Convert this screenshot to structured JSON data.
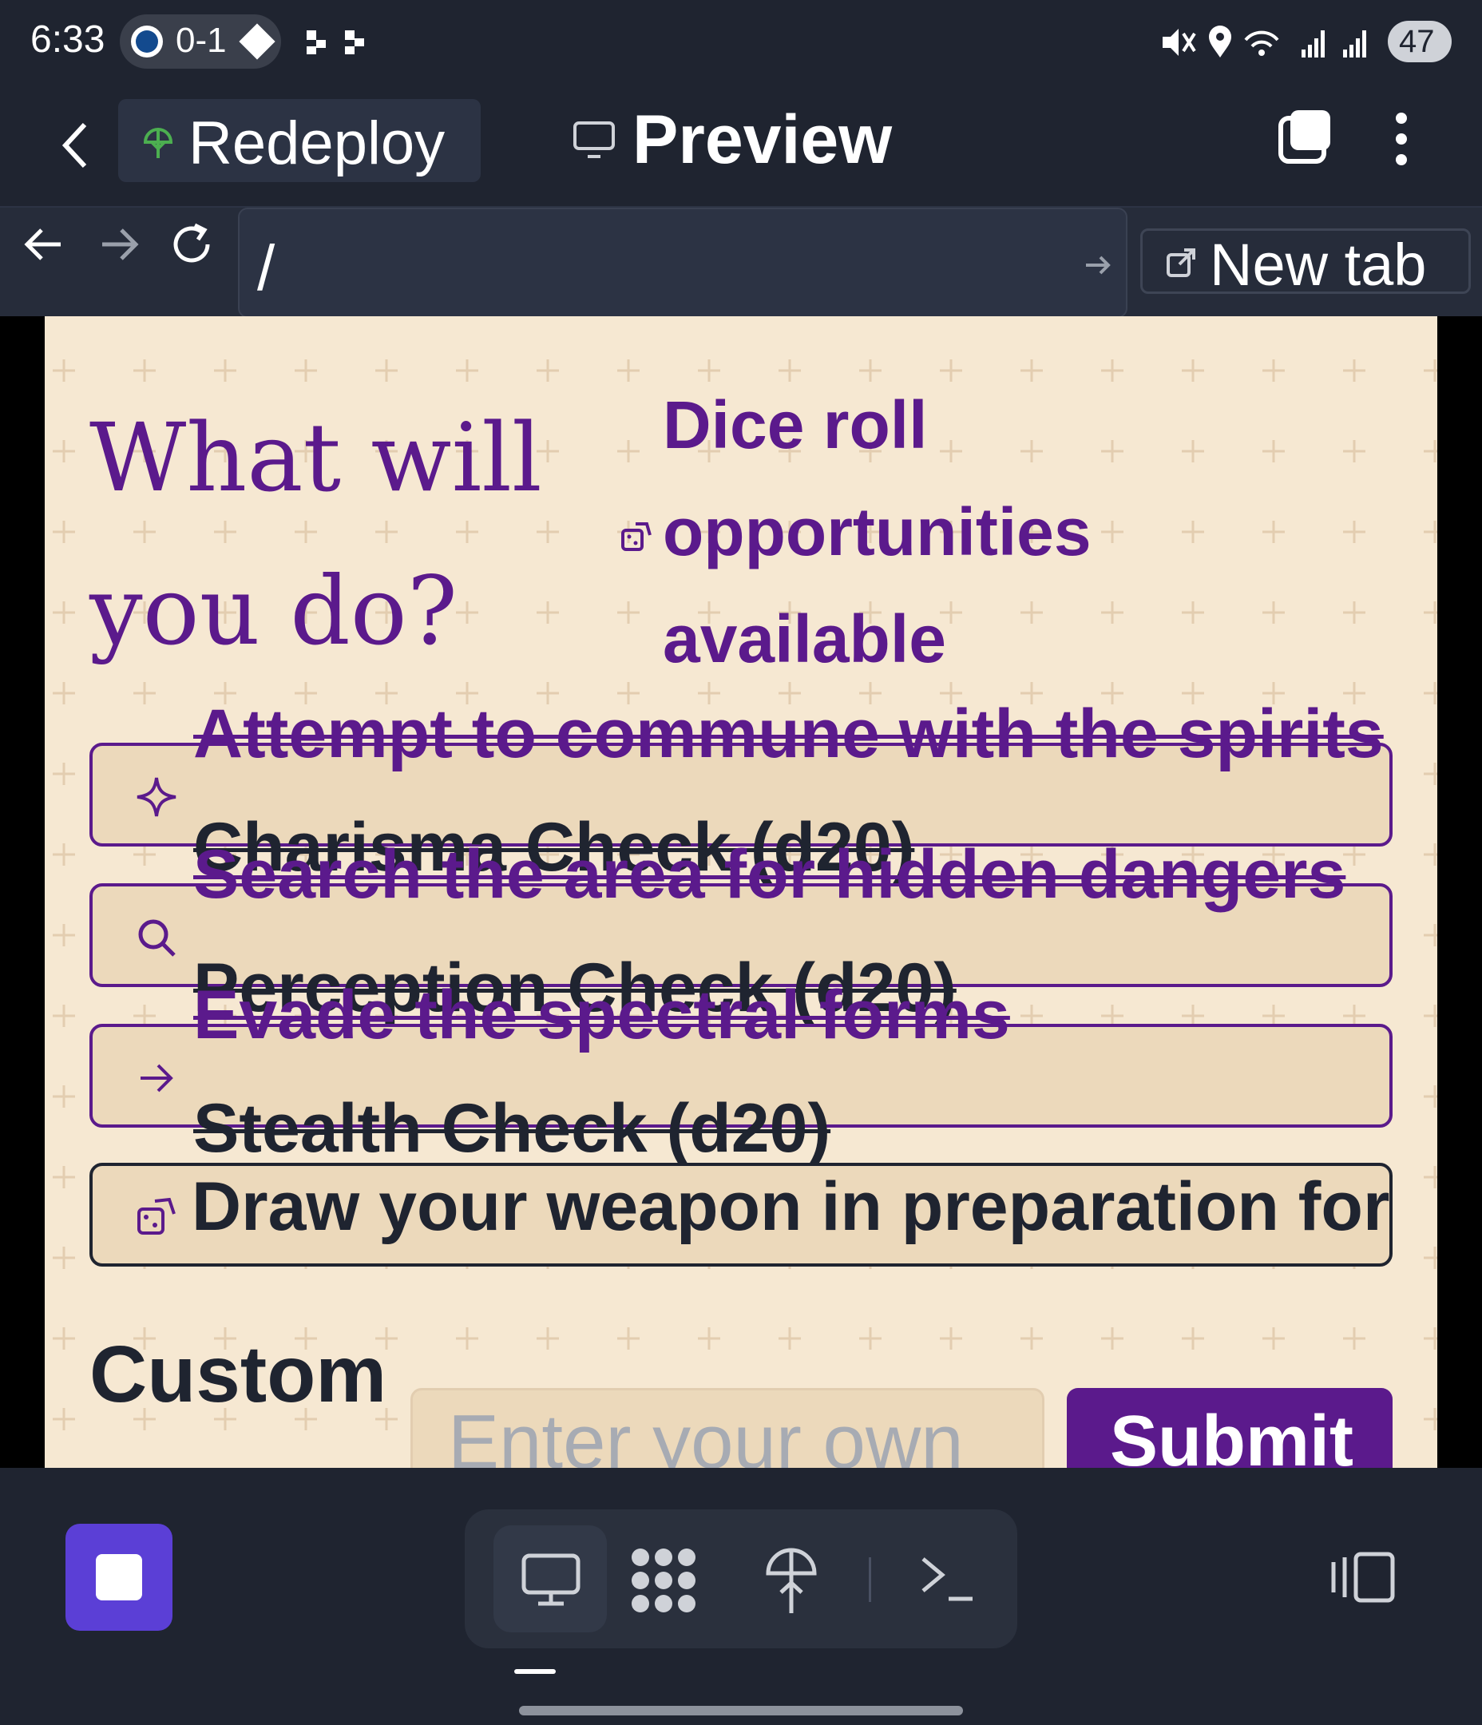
{
  "status": {
    "time": "6:33",
    "score": "0-1",
    "battery": "47"
  },
  "appbar": {
    "deploy_label": "Redeploy",
    "title": "Preview"
  },
  "urlbar": {
    "url": "/",
    "new_tab_label": "New tab"
  },
  "page": {
    "heading_line1": "What will",
    "heading_line2": "you do?",
    "dice_line1": "Dice roll",
    "dice_line2": "opportunities",
    "dice_line3": "available",
    "choices": [
      {
        "title": "Attempt to commune with the spirits",
        "check": "Charisma Check (d20)",
        "icon": "sparkle-icon"
      },
      {
        "title": "Search the area for hidden dangers",
        "check": "Perception Check (d20)",
        "icon": "search-icon"
      },
      {
        "title": "Evade the spectral forms",
        "check": "Stealth Check (d20)",
        "icon": "arrow-right-icon"
      },
      {
        "title": "Draw your weapon in preparation for",
        "check": "",
        "icon": "dice-icon"
      }
    ],
    "custom_label": "Custom",
    "custom_placeholder": "Enter your own",
    "submit_label": "Submit"
  },
  "colors": {
    "accent": "#5b1a8c",
    "page_bg": "#f6e8d2",
    "chrome_bg": "#1f2430",
    "stop_button": "#5b3fd6"
  }
}
